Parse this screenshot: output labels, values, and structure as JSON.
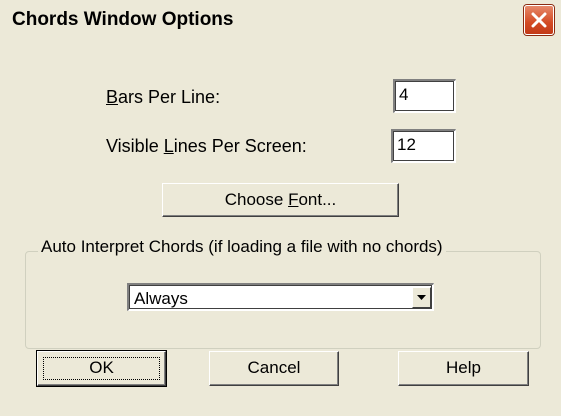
{
  "window": {
    "title": "Chords Window Options",
    "close_icon": "close-icon"
  },
  "fields": {
    "bars_per_line": {
      "label_mnemonic": "B",
      "label_rest": "ars Per Line:",
      "value": "4"
    },
    "visible_lines": {
      "label_pre": "Visible ",
      "label_mnemonic": "L",
      "label_rest": "ines Per Screen:",
      "value": "12"
    }
  },
  "choose_font": {
    "label_pre": "Choose ",
    "label_mnemonic": "F",
    "label_rest": "ont..."
  },
  "auto_interpret": {
    "legend": "Auto Interpret Chords (if loading a file with no chords)",
    "selected": "Always",
    "arrow_icon": "chevron-down-icon"
  },
  "buttons": {
    "ok": "OK",
    "cancel": "Cancel",
    "help": "Help"
  },
  "colors": {
    "dialog_bg": "#ece9d8",
    "close_red": "#d34a24"
  }
}
